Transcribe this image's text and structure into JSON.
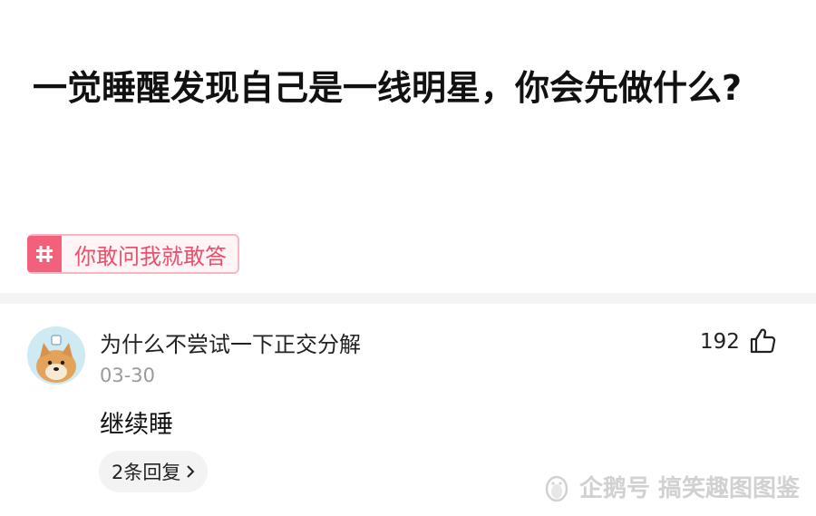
{
  "question": {
    "title": "一觉睡醒发现自己是一线明星，你会先做什么?"
  },
  "topic_tag": {
    "label": "你敢问我就敢答",
    "icon": "hashtag-icon",
    "accent_color": "#f2607a"
  },
  "comment": {
    "username": "为什么不尝试一下正交分解",
    "date": "03-30",
    "like_count": "192",
    "like_icon": "thumbs-up-icon",
    "body": "继续睡",
    "replies_label": "2条回复",
    "avatar": "shiba-dog-avatar"
  },
  "watermark": {
    "text": "企鹅号 搞笑趣图图鉴",
    "icon": "penguin-logo-icon"
  }
}
